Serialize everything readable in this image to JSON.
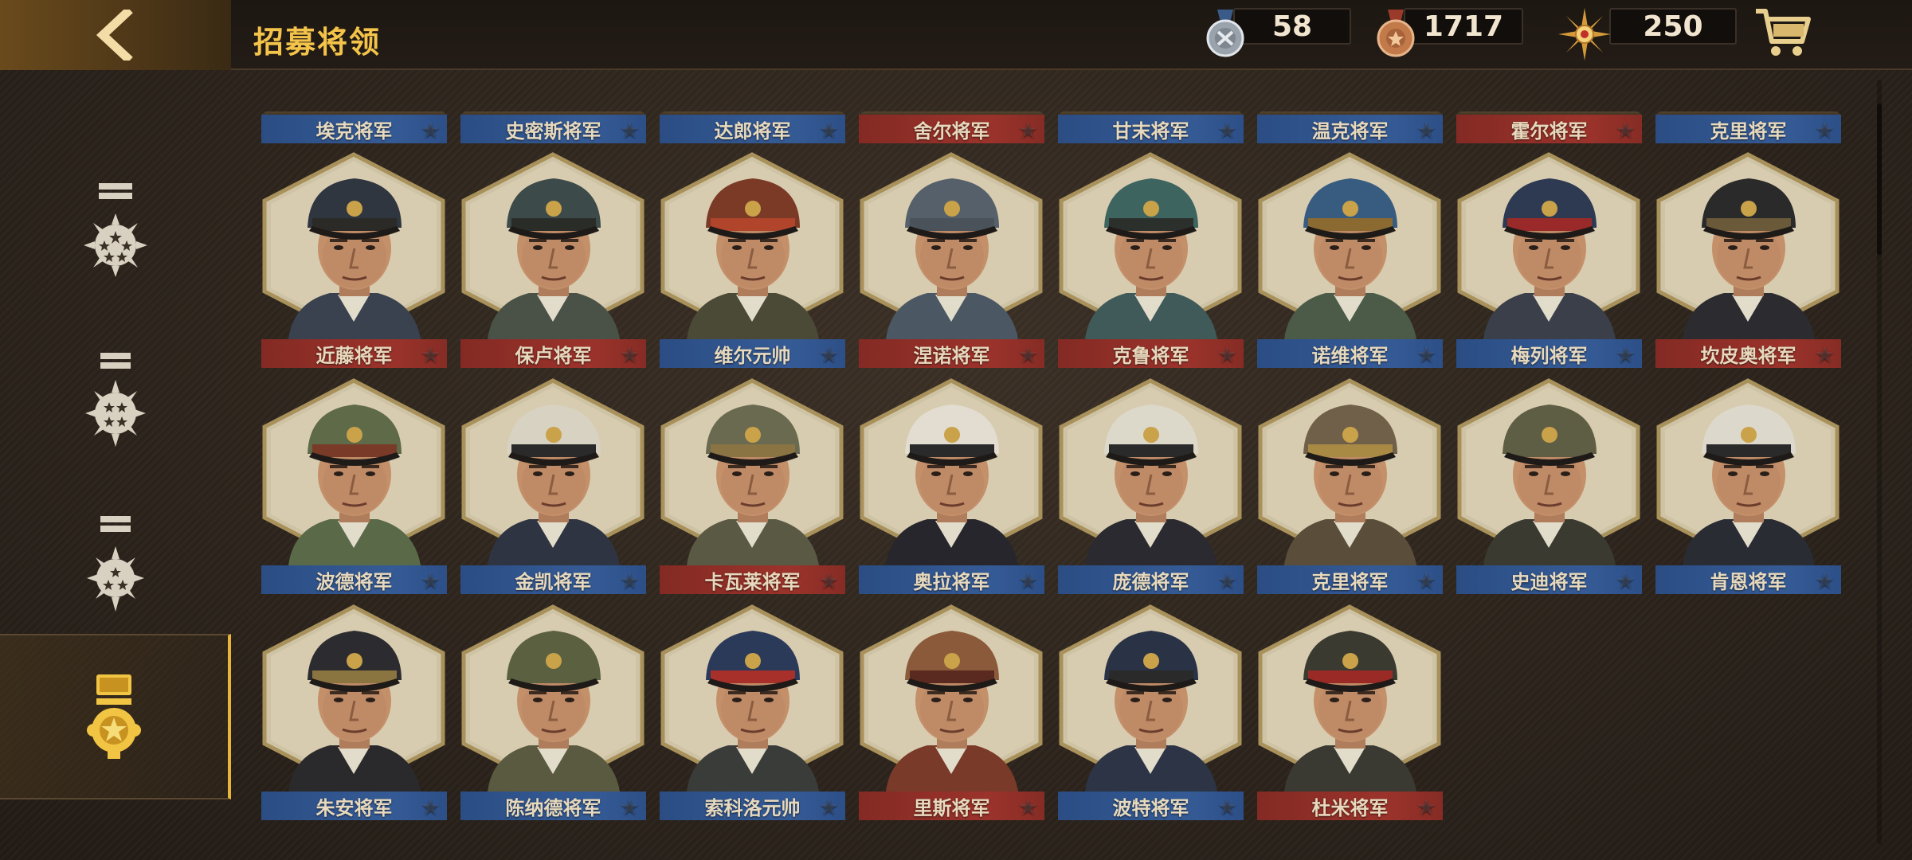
{
  "header": {
    "title": "招募将领",
    "back_icon": "chevron-left-icon"
  },
  "currencies": [
    {
      "name": "silver-medal",
      "value": "58"
    },
    {
      "name": "bronze-medal",
      "value": "1717"
    },
    {
      "name": "gold-sun-badge",
      "value": "250"
    }
  ],
  "cart_icon": "shopping-cart-icon",
  "sidebar": {
    "tabs": [
      {
        "id": "five-star",
        "icon": "five-star-rank-icon",
        "active": false
      },
      {
        "id": "four-star",
        "icon": "four-star-rank-icon",
        "active": false
      },
      {
        "id": "three-star",
        "icon": "three-star-rank-icon",
        "active": false
      },
      {
        "id": "one-star",
        "icon": "one-star-medal-icon",
        "active": true
      }
    ]
  },
  "generals_partial_row": [
    {
      "name": "埃克将军",
      "faction": "blue"
    },
    {
      "name": "史密斯将军",
      "faction": "blue"
    },
    {
      "name": "达郎将军",
      "faction": "blue"
    },
    {
      "name": "舍尔将军",
      "faction": "red"
    },
    {
      "name": "甘末将军",
      "faction": "blue"
    },
    {
      "name": "温克将军",
      "faction": "blue"
    },
    {
      "name": "霍尔将军",
      "faction": "red"
    },
    {
      "name": "克里将军",
      "faction": "blue"
    }
  ],
  "generals": [
    {
      "name": "近藤将军",
      "faction": "red",
      "cap": "#2f3640",
      "band": "#2b2a26",
      "uniform": "#3a4250"
    },
    {
      "name": "保卢将军",
      "faction": "red",
      "cap": "#3c4a4a",
      "band": "#2a2c28",
      "uniform": "#4a5248"
    },
    {
      "name": "维尔元帅",
      "faction": "blue",
      "cap": "#7a3a26",
      "band": "#b0452c",
      "uniform": "#4a4a36"
    },
    {
      "name": "涅诺将军",
      "faction": "red",
      "cap": "#56606a",
      "band": "#4a525a",
      "uniform": "#4c5764"
    },
    {
      "name": "克鲁将军",
      "faction": "red",
      "cap": "#3e6460",
      "band": "#2c302c",
      "uniform": "#3f5a58"
    },
    {
      "name": "诺维将军",
      "faction": "blue",
      "cap": "#385c80",
      "band": "#8a6a30",
      "uniform": "#4c5a48"
    },
    {
      "name": "梅列将军",
      "faction": "blue",
      "cap": "#2e3a52",
      "band": "#9a2a2a",
      "uniform": "#3a3f4a"
    },
    {
      "name": "坎皮奥将军",
      "faction": "red",
      "cap": "#2a2a2a",
      "band": "#6a5a3a",
      "uniform": "#2c2c30"
    },
    {
      "name": "波德将军",
      "faction": "blue",
      "cap": "#5e6a48",
      "band": "#7a3a28",
      "uniform": "#5a6a48"
    },
    {
      "name": "金凯将军",
      "faction": "blue",
      "cap": "#d8d2c2",
      "band": "#2a2a2a",
      "uniform": "#2e3442"
    },
    {
      "name": "卡瓦莱将军",
      "faction": "red",
      "cap": "#6a6a50",
      "band": "#8a7444",
      "uniform": "#5a5a44"
    },
    {
      "name": "奥拉将军",
      "faction": "blue",
      "cap": "#e2ddd0",
      "band": "#2a2a2a",
      "uniform": "#26262c"
    },
    {
      "name": "庞德将军",
      "faction": "blue",
      "cap": "#dcd8ca",
      "band": "#2a2a2a",
      "uniform": "#2a2a30"
    },
    {
      "name": "克里将军",
      "faction": "blue",
      "cap": "#70604a",
      "band": "#a88a44",
      "uniform": "#5a4e3a"
    },
    {
      "name": "史迪将军",
      "faction": "blue",
      "cap": "#5e5e44",
      "band": "#5e5e44",
      "uniform": "#3a3a30"
    },
    {
      "name": "肯恩将军",
      "faction": "blue",
      "cap": "#ddd8cc",
      "band": "#2a2a2a",
      "uniform": "#2a2c34"
    },
    {
      "name": "朱安将军",
      "faction": "blue",
      "cap": "#2c2c30",
      "band": "#8a7440",
      "uniform": "#2a2a2c"
    },
    {
      "name": "陈纳德将军",
      "faction": "blue",
      "cap": "#5a6040",
      "band": "#5a6040",
      "uniform": "#5a5a40"
    },
    {
      "name": "索科洛元帅",
      "faction": "blue",
      "cap": "#2c3a5a",
      "band": "#a8302a",
      "uniform": "#3a3c3a"
    },
    {
      "name": "里斯将军",
      "faction": "red",
      "cap": "#8a5a3a",
      "band": "#5a2a20",
      "uniform": "#7a3a2a"
    },
    {
      "name": "波特将军",
      "faction": "blue",
      "cap": "#2a3246",
      "band": "#2a2a2a",
      "uniform": "#2c3446"
    },
    {
      "name": "杜米将军",
      "faction": "red",
      "cap": "#3a3a30",
      "band": "#9a2a26",
      "uniform": "#3a3a32"
    }
  ]
}
